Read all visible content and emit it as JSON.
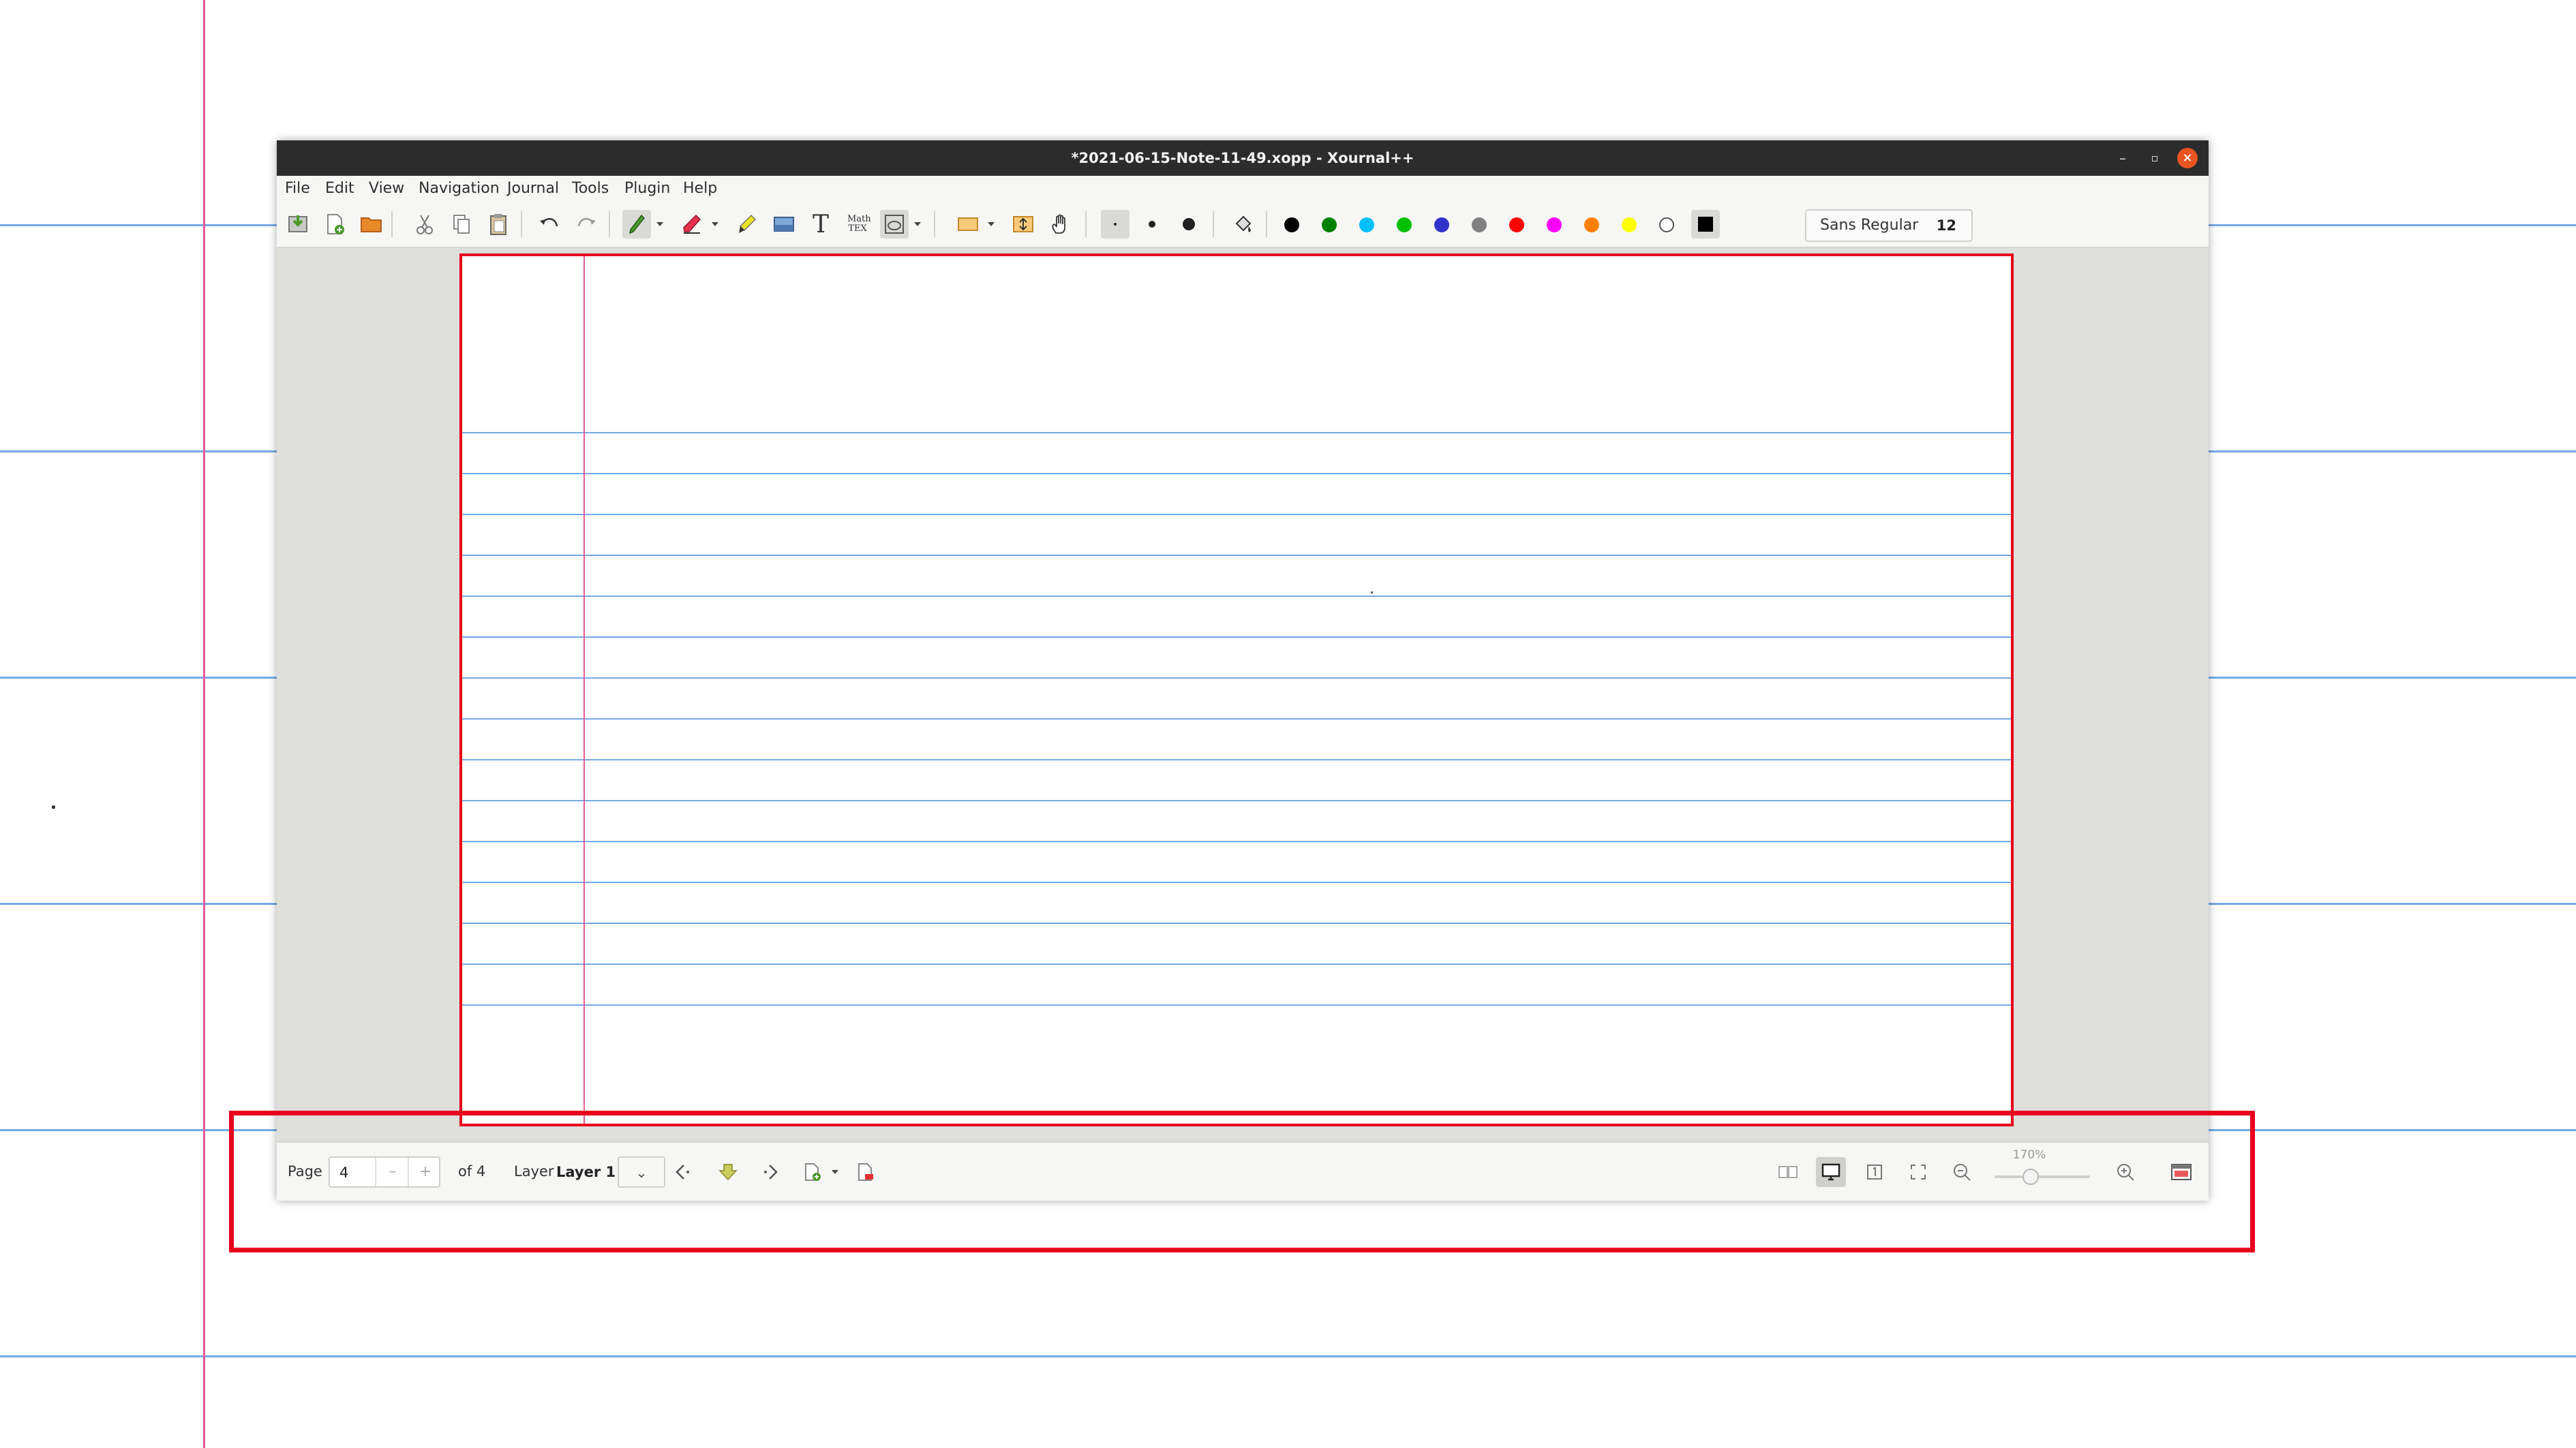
{
  "window": {
    "title": "*2021-06-15-Note-11-49.xopp - Xournal++"
  },
  "window_controls": {
    "minimize": "–",
    "maximize": "▫",
    "close": "×"
  },
  "menu": [
    "File",
    "Edit",
    "View",
    "Navigation",
    "Journal",
    "Tools",
    "Plugin",
    "Help"
  ],
  "toolbar": {
    "math_tex_label": "Math TEX",
    "text_tool_glyph": "T",
    "font": {
      "name": "Sans Regular",
      "size": "12"
    },
    "colors": [
      "#000000",
      "#008000",
      "#00c0ff",
      "#00c000",
      "#3333cc",
      "#808080",
      "#ff0000",
      "#ff00ff",
      "#ff8000",
      "#ffff00",
      "#ffffff"
    ],
    "active_color": "#000000"
  },
  "statusbar": {
    "page_label": "Page",
    "page_value": "4",
    "spin_minus": "–",
    "spin_plus": "+",
    "page_total": "of 4",
    "layer_label": "Layer",
    "layer_value": "Layer 1",
    "zoom": "170%",
    "zoom_level_percent": 170
  },
  "highlight_color": "#e8001c"
}
